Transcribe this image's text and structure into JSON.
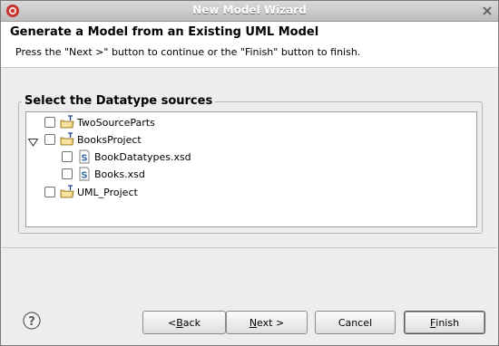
{
  "window": {
    "title": "New Model Wizard"
  },
  "header": {
    "title": "Generate a Model from an Existing UML Model",
    "message": "Press the \"Next >\" button to continue or the \"Finish\" button to finish."
  },
  "group": {
    "label": "Select the Datatype sources"
  },
  "tree": {
    "items": [
      {
        "label": "TwoSourceParts",
        "checked": false,
        "icon": "uml-project-folder-icon",
        "expanded": false
      },
      {
        "label": "BooksProject",
        "checked": false,
        "icon": "uml-project-folder-icon",
        "expanded": true
      },
      {
        "label": "BookDatatypes.xsd",
        "checked": false,
        "icon": "xsd-schema-file-icon"
      },
      {
        "label": "Books.xsd",
        "checked": false,
        "icon": "xsd-schema-file-icon"
      },
      {
        "label": "UML_Project",
        "checked": false,
        "icon": "uml-project-folder-icon",
        "expanded": false
      }
    ]
  },
  "buttons": {
    "back_pre": "< ",
    "back_u": "B",
    "back_post": "ack",
    "next_u": "N",
    "next_post": "ext >",
    "cancel": "Cancel",
    "finish_u": "F",
    "finish_post": "inish"
  },
  "colors": {
    "header_bg": "#ffffff",
    "dialog_bg": "#ededed",
    "icon_accent": "#3a6ea5"
  }
}
